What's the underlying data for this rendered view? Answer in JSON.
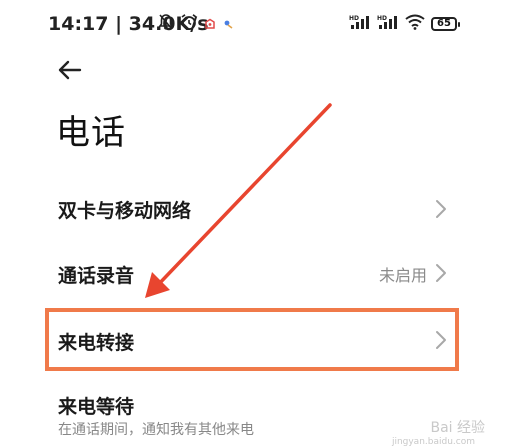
{
  "status_bar": {
    "time_speed": "14:17 | 34.0K/s",
    "battery_level": "65",
    "icons_left": [
      "mute-bell-icon",
      "alarm-icon",
      "notification-icon-red",
      "notification-icon-blue"
    ],
    "icons_right": [
      "hd-signal-icon",
      "hd-signal-icon",
      "wifi-icon",
      "battery-icon"
    ]
  },
  "header": {
    "title": "电话"
  },
  "rows": [
    {
      "label": "双卡与移动网络",
      "value": ""
    },
    {
      "label": "通话录音",
      "value": "未启用"
    },
    {
      "label": "来电转接",
      "value": ""
    },
    {
      "label": "来电等待",
      "value": "",
      "subtitle": "在通话期间，通知我有其他来电"
    }
  ],
  "annotation": {
    "highlight_color": "#f07a4a",
    "arrow_color": "#e8452f"
  },
  "watermark": {
    "text": "Bai 经验",
    "url": "jingyan.baidu.com"
  }
}
